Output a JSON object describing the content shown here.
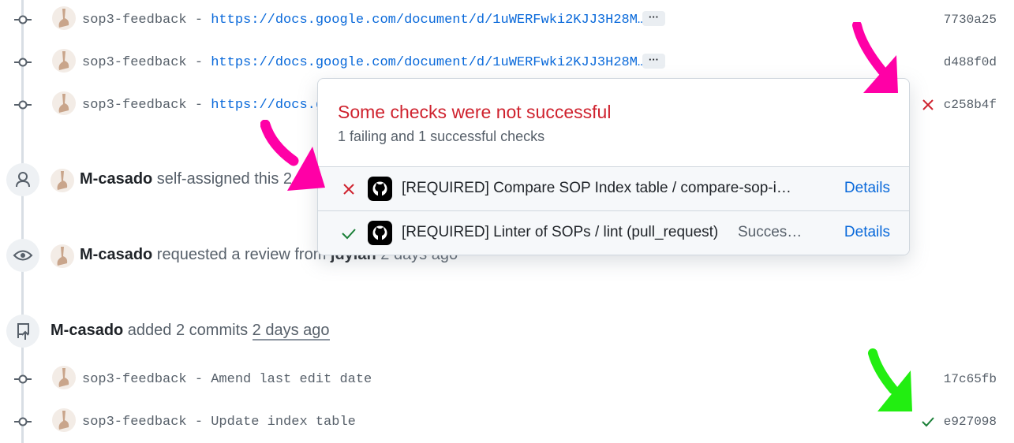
{
  "colors": {
    "accent": "#0969da",
    "fail": "#cf222e",
    "success": "#1a7f37",
    "magenta_arrow": "#ff00a6",
    "green_arrow": "#22ee11"
  },
  "commits_top": [
    {
      "title": "sop3-feedback - ",
      "link": "https://docs.google.com/document/d/1uWERFwki2KJJ3H28M…",
      "more": "···",
      "sha": "7730a25",
      "status": "none"
    },
    {
      "title": "sop3-feedback - ",
      "link": "https://docs.google.com/document/d/1uWERFwki2KJJ3H28M…",
      "more": "···",
      "sha": "d488f0d",
      "status": "none"
    },
    {
      "title": "sop3-feedback - ",
      "link": "https://docs.g",
      "sha": "c258b4f",
      "status": "fail"
    }
  ],
  "events": {
    "assign": {
      "user": "M-casado",
      "text": " self-assigned this 2 da"
    },
    "review": {
      "user": "M-casado",
      "text": " requested a review from ",
      "reviewer": "jdylan",
      "time": " 2 days ago"
    },
    "commits": {
      "user": "M-casado",
      "text": " added 2 commits ",
      "time": "2 days ago"
    }
  },
  "commits_bottom": [
    {
      "title": "sop3-feedback - Amend last edit date",
      "sha": "17c65fb",
      "status": "none"
    },
    {
      "title": "sop3-feedback - Update index table",
      "sha": "e927098",
      "status": "success"
    }
  ],
  "popover": {
    "title": "Some checks were not successful",
    "subtitle": "1 failing and 1 successful checks",
    "checks": [
      {
        "name": "[REQUIRED] Compare SOP Index table / compare-sop-i…",
        "state": "",
        "status": "fail",
        "details": "Details"
      },
      {
        "name": "[REQUIRED] Linter of SOPs / lint (pull_request)",
        "state": "Succes…",
        "status": "success",
        "details": "Details"
      }
    ]
  }
}
